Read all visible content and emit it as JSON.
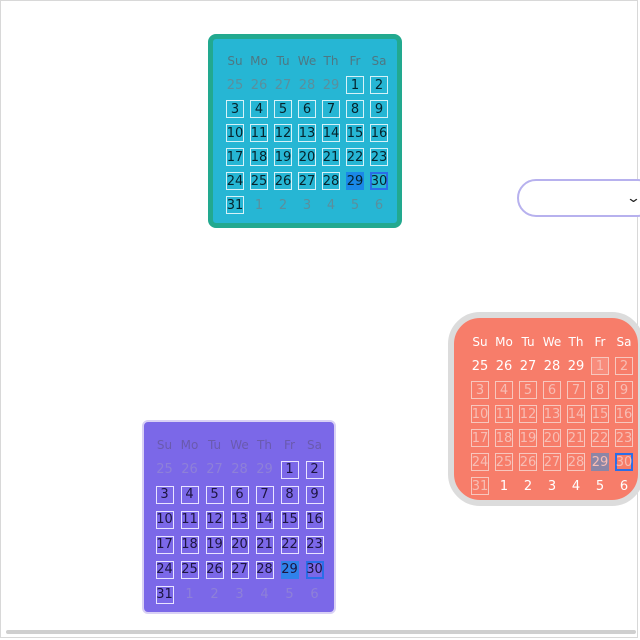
{
  "weekdays": [
    "Su",
    "Mo",
    "Tu",
    "We",
    "Th",
    "Fr",
    "Sa"
  ],
  "calendars": [
    {
      "name": "teal",
      "leading_days": [
        "25",
        "26",
        "27",
        "28",
        "29"
      ],
      "month_days": [
        "1",
        "2",
        "3",
        "4",
        "5",
        "6",
        "7",
        "8",
        "9",
        "10",
        "11",
        "12",
        "13",
        "14",
        "15",
        "16",
        "17",
        "18",
        "19",
        "20",
        "21",
        "22",
        "23",
        "24",
        "25",
        "26",
        "27",
        "28",
        "29",
        "30",
        "31"
      ],
      "trailing_days": [
        "1",
        "2",
        "3",
        "4",
        "5",
        "6"
      ],
      "today": "29",
      "selected": "30"
    },
    {
      "name": "coral",
      "leading_days": [
        "25",
        "26",
        "27",
        "28",
        "29"
      ],
      "month_days": [
        "1",
        "2",
        "3",
        "4",
        "5",
        "6",
        "7",
        "8",
        "9",
        "10",
        "11",
        "12",
        "13",
        "14",
        "15",
        "16",
        "17",
        "18",
        "19",
        "20",
        "21",
        "22",
        "23",
        "24",
        "25",
        "26",
        "27",
        "28",
        "29",
        "30",
        "31"
      ],
      "trailing_days": [
        "1",
        "2",
        "3",
        "4",
        "5",
        "6"
      ],
      "today": "29",
      "selected": "30"
    },
    {
      "name": "violet",
      "leading_days": [
        "25",
        "26",
        "27",
        "28",
        "29"
      ],
      "month_days": [
        "1",
        "2",
        "3",
        "4",
        "5",
        "6",
        "7",
        "8",
        "9",
        "10",
        "11",
        "12",
        "13",
        "14",
        "15",
        "16",
        "17",
        "18",
        "19",
        "20",
        "21",
        "22",
        "23",
        "24",
        "25",
        "26",
        "27",
        "28",
        "29",
        "30",
        "31"
      ],
      "trailing_days": [
        "1",
        "2",
        "3",
        "4",
        "5",
        "6"
      ],
      "today": "29",
      "selected": "30"
    }
  ],
  "dropdown": {
    "value": "",
    "icon": "chevron-down-icon"
  },
  "colors": {
    "teal_bg": "#26b6d4",
    "teal_border": "#22a98f",
    "coral_bg": "#f77d6a",
    "violet_bg": "#7b68e8",
    "today": "#1a88e8",
    "selected_outline": "#2a6ee8"
  }
}
